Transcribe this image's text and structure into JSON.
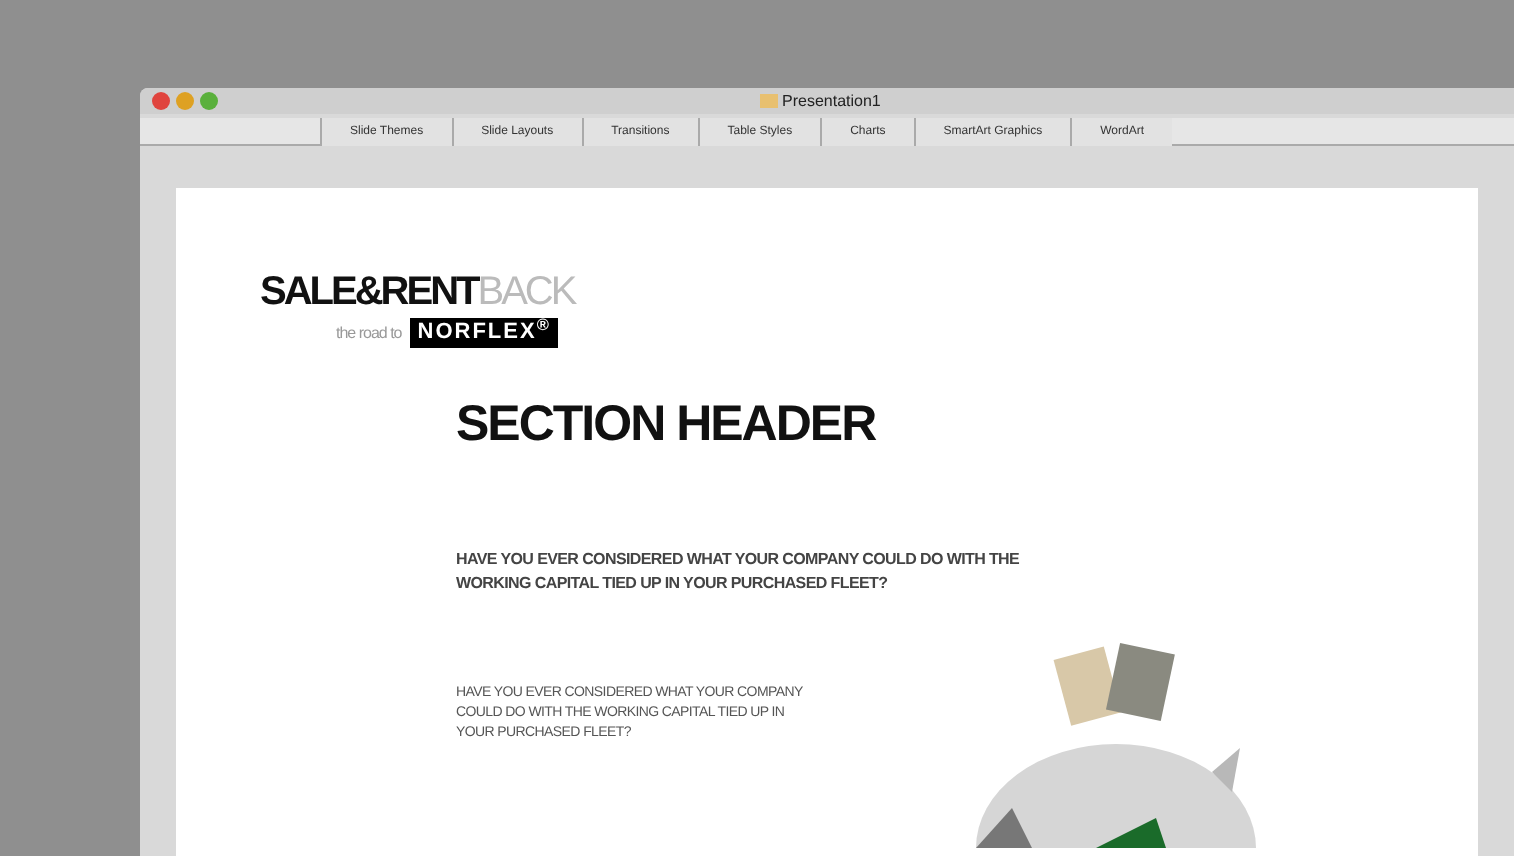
{
  "window": {
    "title": "Presentation1"
  },
  "ribbon_tabs": [
    "Slide Themes",
    "Slide Layouts",
    "Transitions",
    "Table Styles",
    "Charts",
    "SmartArt Graphics",
    "WordArt"
  ],
  "slide": {
    "logo": {
      "dark": "SALE&RENT",
      "light": "BACK",
      "tagline": "the road to",
      "brand": "NORFLEX$^{®}$"
    },
    "title": "SECTION HEADER",
    "paragraphs": [
      "HAVE YOU EVER CONSIDERED WHAT YOUR COMPANY COULD DO WITH THE WORKING CAPITAL TIED UP IN YOUR PURCHASED FLEET?",
      "HAVE YOU EVER CONSIDERED WHAT YOUR COMPANY COULD DO WITH THE WORKING CAPITAL TIED UP IN YOUR PURCHASED FLEET?"
    ]
  }
}
